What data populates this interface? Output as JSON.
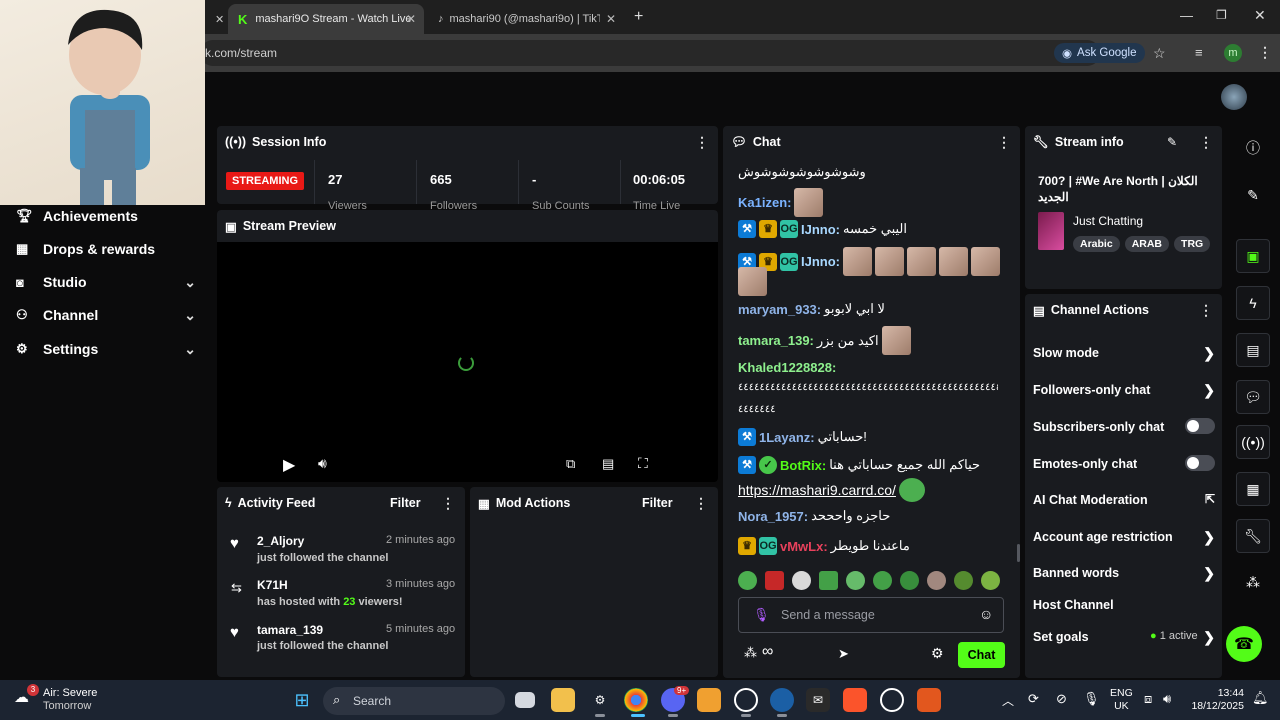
{
  "browser": {
    "tabs": [
      {
        "label": "mashari9O Stream - Watch Live"
      },
      {
        "label": "mashari90 (@mashari9o) | TikTo"
      }
    ],
    "url": "k.com/stream",
    "ask_google": "Ask Google",
    "profile_initial": "m"
  },
  "sidebar": {
    "items": [
      {
        "label": "Achievements",
        "icon": "trophy-icon"
      },
      {
        "label": "Drops & rewards",
        "icon": "drops-icon"
      },
      {
        "label": "Studio",
        "icon": "studio-icon"
      },
      {
        "label": "Channel",
        "icon": "channel-icon"
      },
      {
        "label": "Settings",
        "icon": "gear-icon"
      }
    ]
  },
  "session": {
    "title": "Session Info",
    "status": "STREAMING",
    "viewers": "27",
    "viewers_label": "Viewers",
    "followers": "665",
    "followers_label": "Followers",
    "subs": "-",
    "subs_label": "Sub Counts",
    "time": "00:06:05",
    "time_label": "Time Live"
  },
  "preview": {
    "title": "Stream Preview"
  },
  "activity": {
    "title": "Activity Feed",
    "filter": "Filter",
    "items": [
      {
        "name": "2_Aljory",
        "time": "2 minutes ago",
        "desc": "just followed the channel"
      },
      {
        "name": "K71H",
        "time": "3 minutes ago",
        "desc_a": "has hosted with ",
        "count": "23",
        "desc_b": " viewers!"
      },
      {
        "name": "tamara_139",
        "time": "5 minutes ago",
        "desc": "just followed the channel"
      }
    ]
  },
  "mod": {
    "title": "Mod Actions",
    "filter": "Filter"
  },
  "chat": {
    "title": "Chat",
    "m0_text": "وشوشوشوشوشوشوش",
    "m1_user": "Ka1izen:",
    "m2_user": "IJnno:",
    "m2_text": "اليبي خمسه",
    "m3_user": "IJnno:",
    "m4_user": "maryam_933:",
    "m4_text": "لا ابي لابوبو",
    "m5_user": "tamara_139:",
    "m5_text": "اكيد من بزر",
    "m6_user": "Khaled1228828:",
    "m6_text_a": "٤٤٤٤٤٤٤٤٤٤٤٤٤٤٤٤٤٤٤٤٤٤٤٤٤٤٤٤٤٤٤٤٤٤٤٤٤٤٤٤٤٤٤٤٤٤٤٤٤٤",
    "m6_text_b": "٤٤٤٤٤٤٤",
    "m7_user": "1Layanz:",
    "m7_text": "حساباتي!",
    "m8_user": "BotRix:",
    "m8_text": "حياكم الله جميع حساباتي هنا",
    "m8_link": "https://mashari9.carrd.co/",
    "m9_user": "Nora_1957:",
    "m9_text": "حاجزه واحححد",
    "m10_user": "vMwLx:",
    "m10_text": "ماعندنا طويطر",
    "placeholder": "Send a message",
    "infinity": "∞",
    "send": "Chat"
  },
  "stream_info": {
    "title": "Stream info",
    "stream_title": "700? | #We Are North | الكلان الجديد",
    "category": "Just Chatting",
    "tags": [
      "Arabic",
      "ARAB",
      "TRG"
    ]
  },
  "actions": {
    "title": "Channel Actions",
    "items": [
      {
        "label": "Slow mode"
      },
      {
        "label": "Followers-only chat"
      },
      {
        "label": "Subscribers-only chat"
      },
      {
        "label": "Emotes-only chat"
      },
      {
        "label": "AI Chat Moderation"
      },
      {
        "label": "Account age restriction"
      },
      {
        "label": "Banned words"
      },
      {
        "label": "Host Channel"
      },
      {
        "label": "Set goals"
      }
    ],
    "goals_active": "1 active"
  },
  "taskbar": {
    "weather_badge": "3",
    "weather_title": "Air: Severe",
    "weather_sub": "Tomorrow",
    "search": "Search",
    "lang1": "ENG",
    "lang2": "UK",
    "time": "13:44",
    "date": "18/12/2025",
    "discord_badge": "9+"
  },
  "colors": {
    "accent": "#53fc18",
    "streaming": "#e91916",
    "mod_badge": "#0c7bd6",
    "link": "#ffffff"
  }
}
